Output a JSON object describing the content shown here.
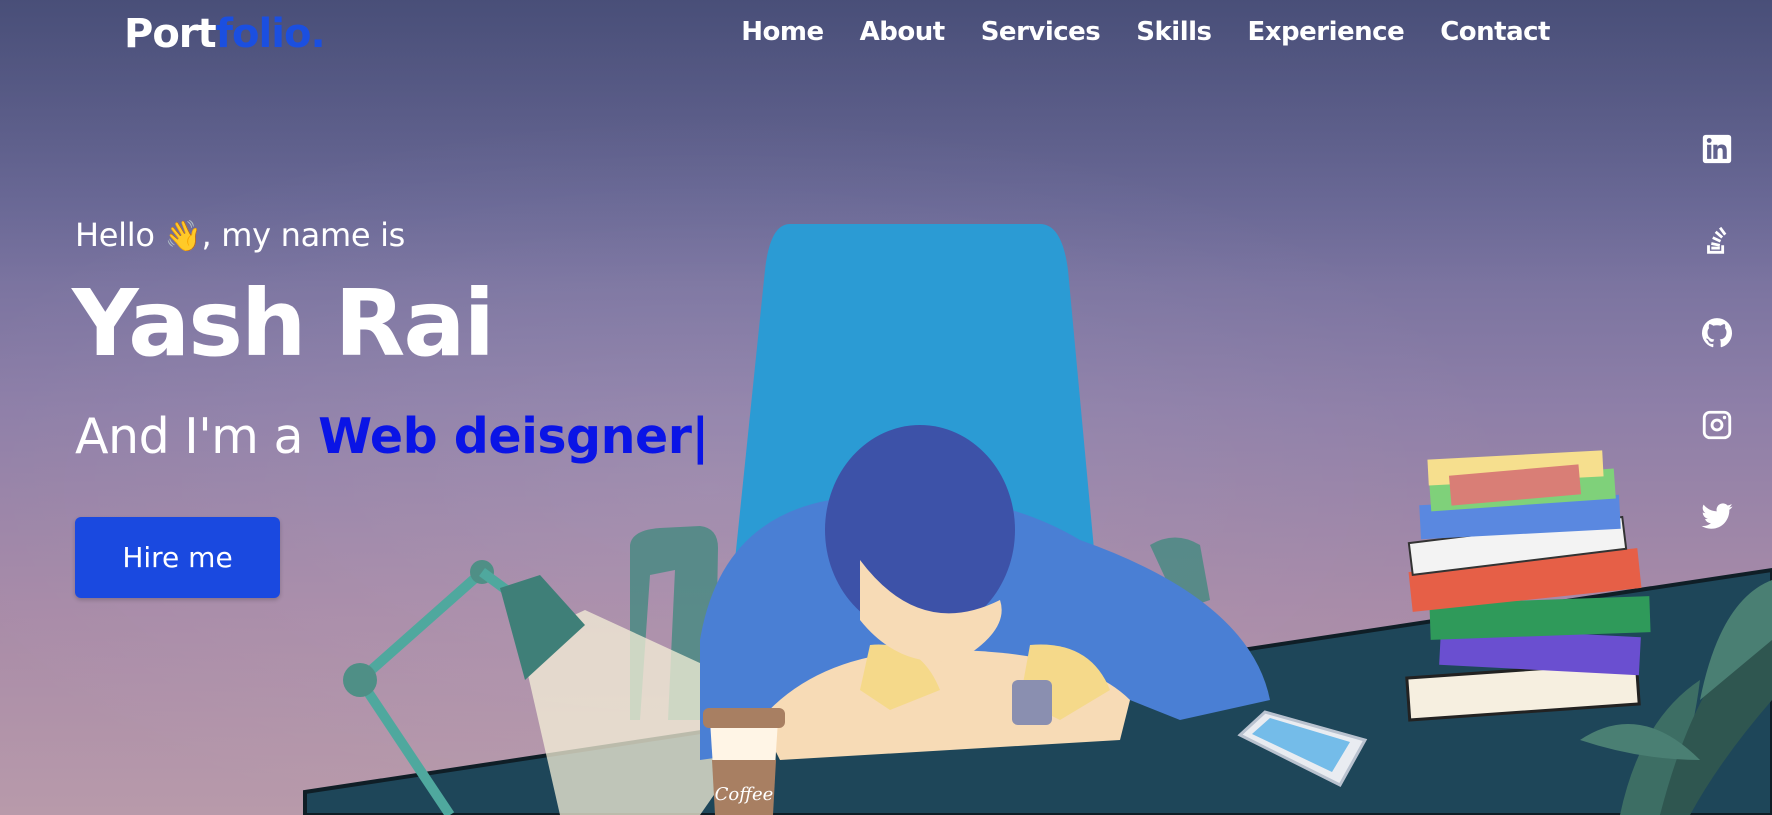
{
  "logo": {
    "part1": "Port",
    "part2": "folio."
  },
  "nav": {
    "items": [
      {
        "label": "Home"
      },
      {
        "label": "About"
      },
      {
        "label": "Services"
      },
      {
        "label": "Skills"
      },
      {
        "label": "Experience"
      },
      {
        "label": "Contact"
      }
    ]
  },
  "hero": {
    "greeting_before": "Hello ",
    "greeting_emoji": "👋",
    "greeting_after": ", my name is",
    "name": "Yash Rai",
    "role_prefix": "And I'm a ",
    "role_typed": "Web deisgner|",
    "cta_label": "Hire me"
  },
  "social": {
    "icons": [
      "linkedin-icon",
      "stackoverflow-icon",
      "github-icon",
      "instagram-icon",
      "twitter-icon"
    ]
  },
  "illustration": {
    "coffee_label": "Coffee"
  },
  "colors": {
    "accent": "#1a49e0",
    "typed_text": "#0a14e6",
    "logo_accent": "#1b4fe0"
  }
}
